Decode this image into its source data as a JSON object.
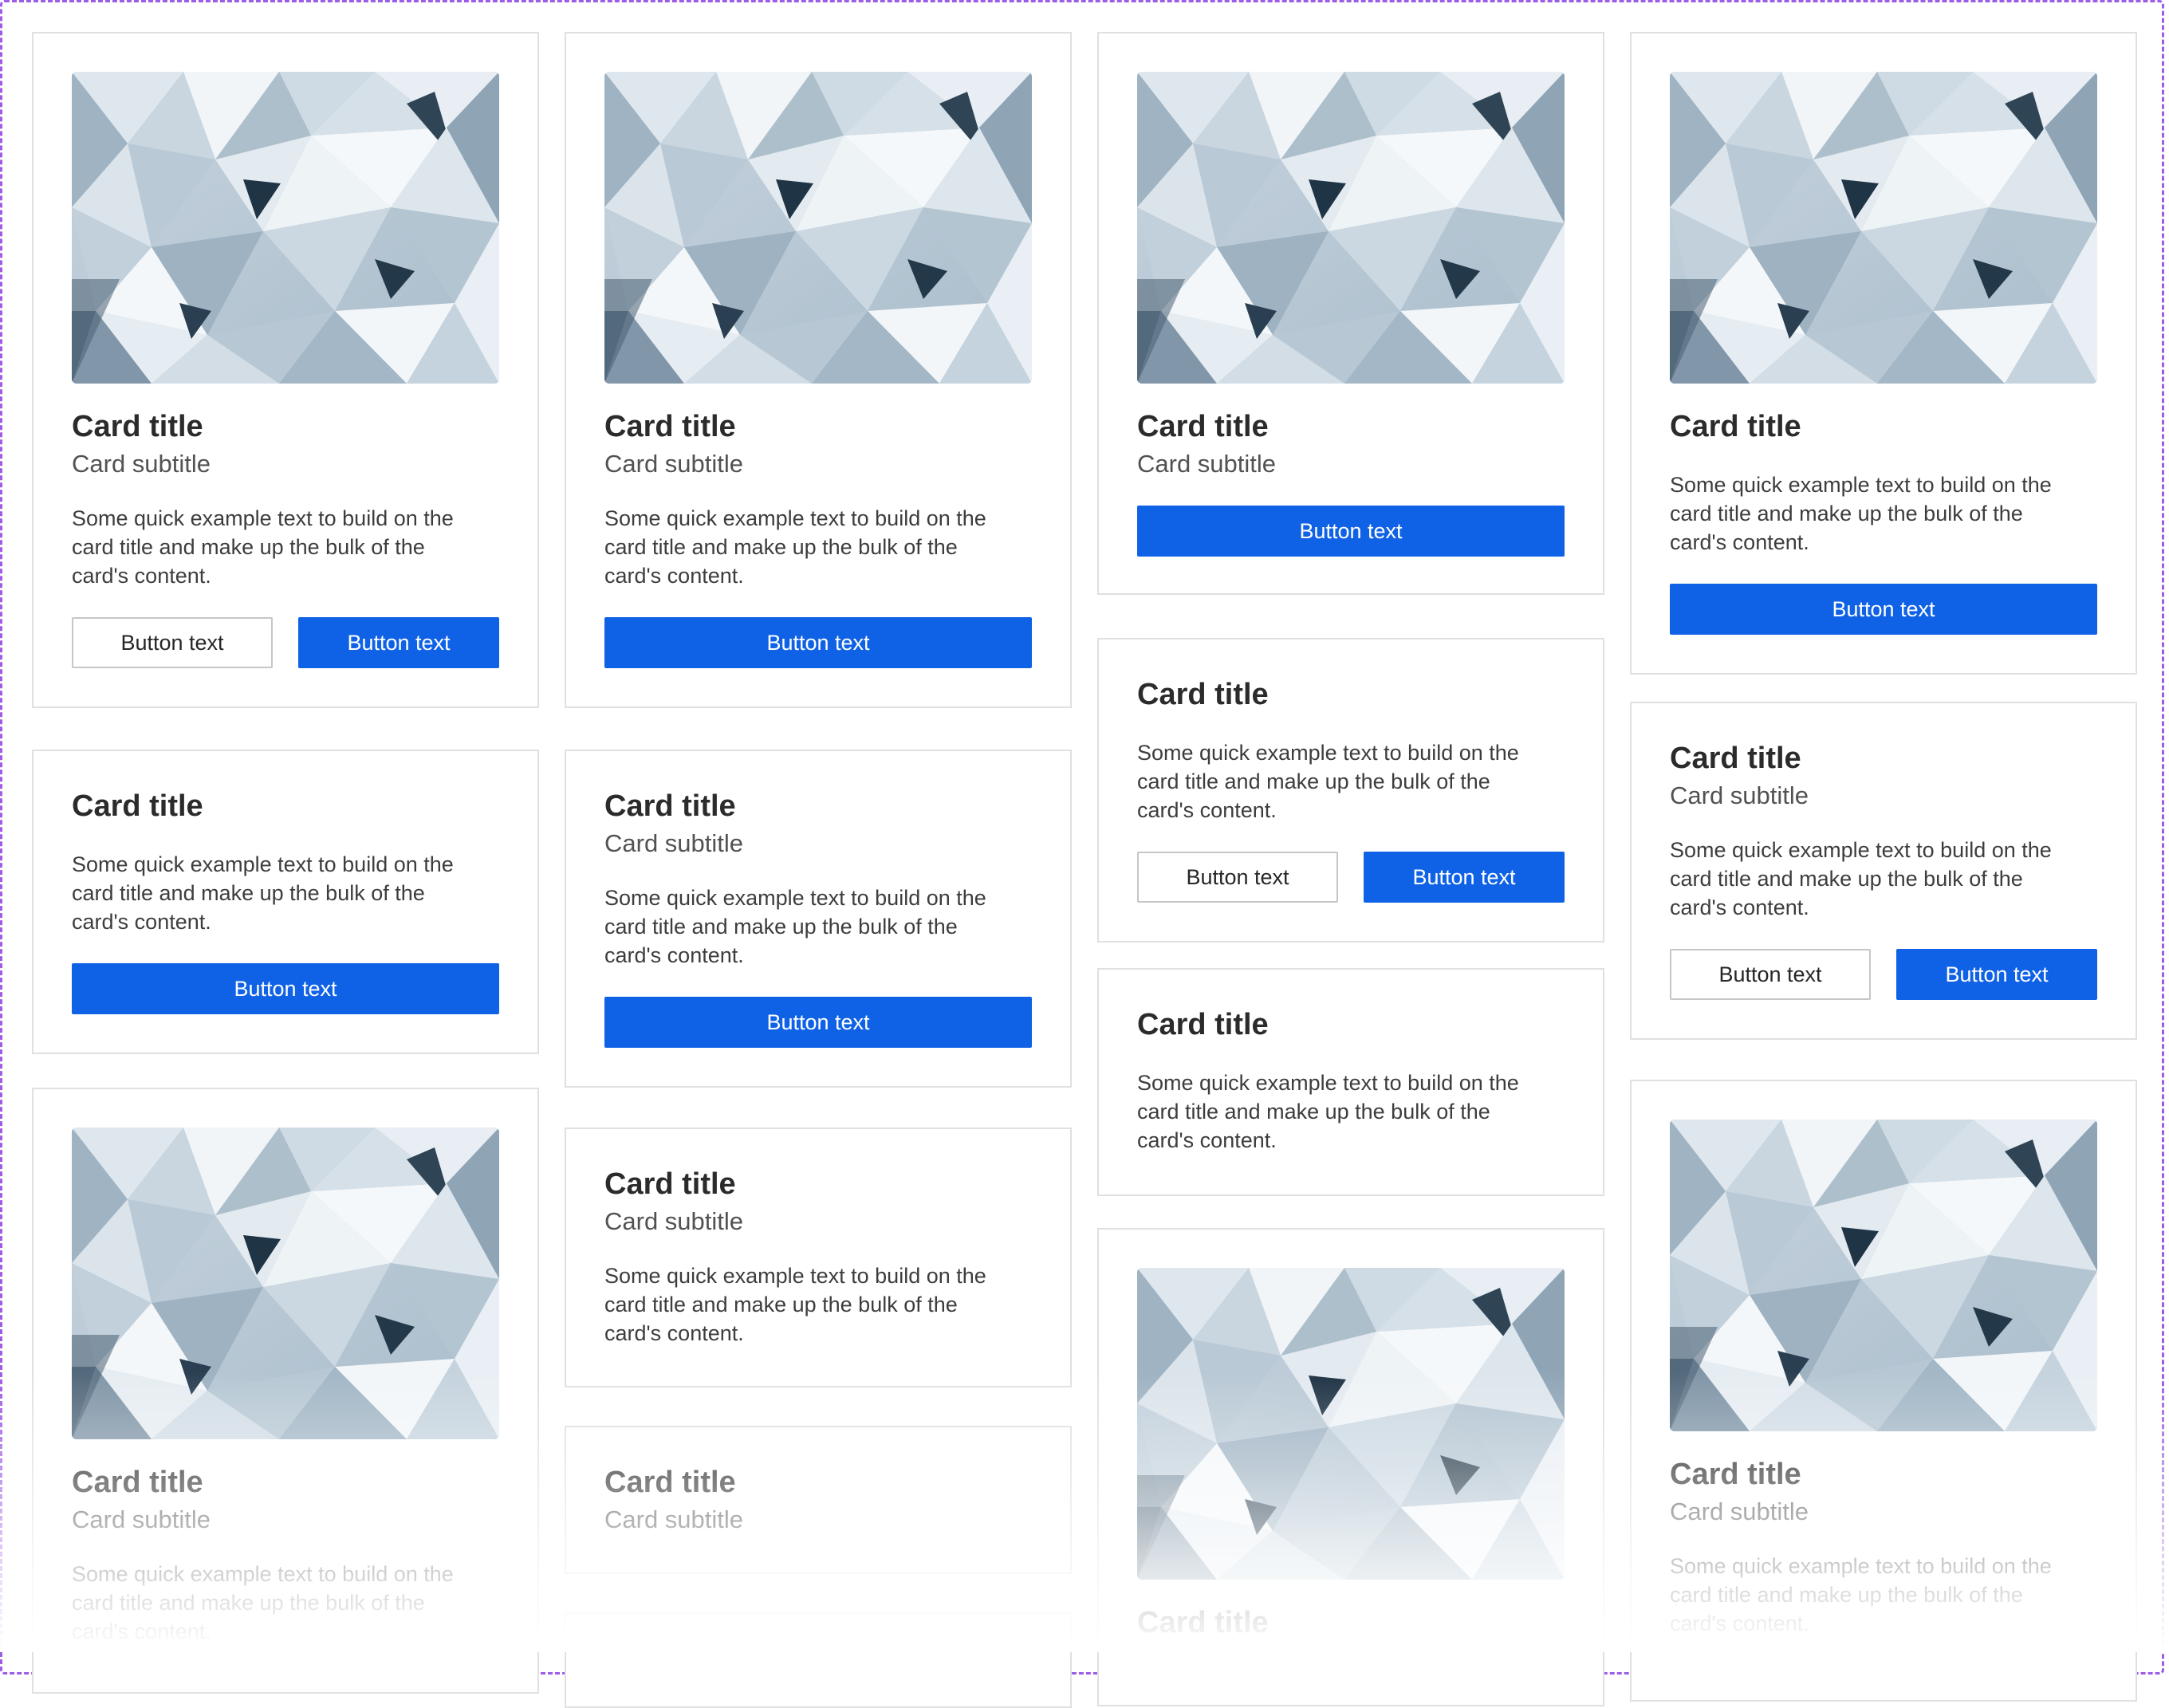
{
  "cards": [
    {
      "title": "Card title",
      "subtitle": "Card subtitle",
      "text": "Some quick example text to build on the card title and make up the bulk of the card's content.",
      "primary_button": "Button text",
      "secondary_button": "Button text"
    },
    {
      "title": "Card title",
      "text": "Some quick example text to build on the card title and make up the bulk of the card's content.",
      "primary_button": "Button text"
    },
    {
      "title": "Card title",
      "subtitle": "Card subtitle",
      "text": "Some quick example text to build on the card title and make up the bulk of the card's content."
    },
    {
      "title": "Card title",
      "subtitle": "Card subtitle",
      "text": "Some quick example text to build on the card title and make up the bulk of the card's content.",
      "primary_button": "Button text"
    },
    {
      "title": "Card title",
      "subtitle": "Card subtitle",
      "text": "Some quick example text to build on the card title and make up the bulk of the card's content.",
      "primary_button": "Button text"
    },
    {
      "title": "Card title",
      "subtitle": "Card subtitle",
      "text": "Some quick example text to build on the card title and make up the bulk of the card's content."
    },
    {
      "title": "Card title",
      "subtitle": "Card subtitle"
    },
    {
      "title": "Card title",
      "subtitle": "Card subtitle",
      "primary_button": "Button text"
    },
    {
      "title": "Card title",
      "text": "Some quick example text to build on the card title and make up the bulk of the card's content.",
      "primary_button": "Button text",
      "secondary_button": "Button text"
    },
    {
      "title": "Card title",
      "text": "Some quick example text to build on the card title and make up the bulk of the card's content."
    },
    {
      "title": "Card title"
    },
    {
      "title": "Card title",
      "text": "Some quick example text to build on the card title and make up the bulk of the card's content.",
      "primary_button": "Button text"
    },
    {
      "title": "Card title",
      "subtitle": "Card subtitle",
      "text": "Some quick example text to build on the card title and make up the bulk of the card's content.",
      "primary_button": "Button text",
      "secondary_button": "Button text"
    },
    {
      "title": "Card title",
      "subtitle": "Card subtitle",
      "text": "Some quick example text to build on the card title and make up the bulk of the card's content."
    }
  ],
  "colors": {
    "primary_button": "#0f62e6",
    "card_border": "#e0e0e0",
    "frame_border": "#9d5ce6"
  }
}
